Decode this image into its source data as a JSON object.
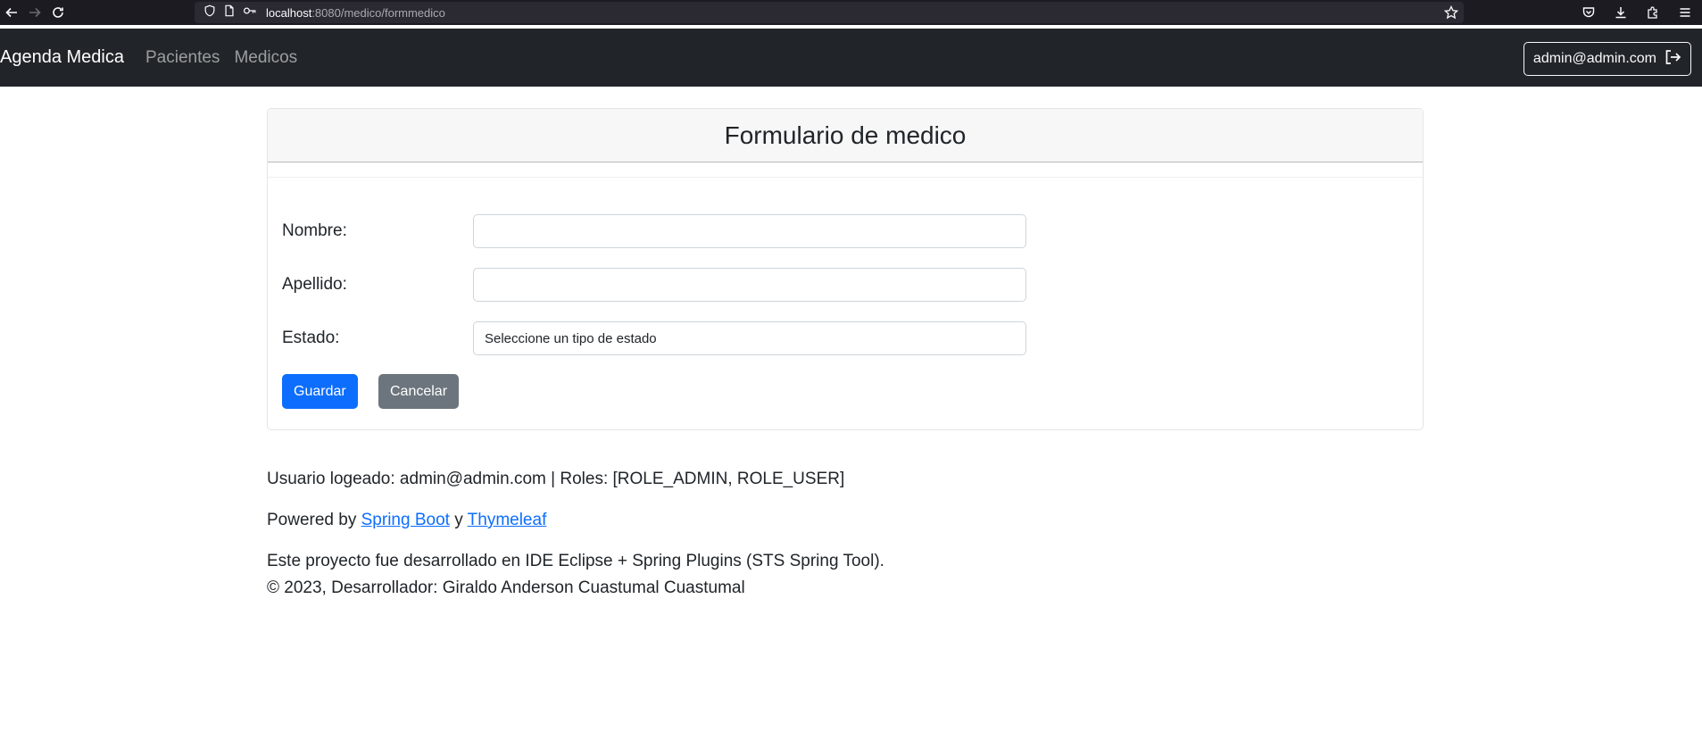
{
  "browser": {
    "url_host": "localhost",
    "url_path": ":8080/medico/formmedico",
    "icons": [
      "back-arrow-icon",
      "forward-arrow-icon",
      "reload-icon",
      "shield-icon",
      "page-icon",
      "key-icon",
      "bookmark-star-icon",
      "pocket-icon",
      "download-icon",
      "extensions-icon",
      "menu-icon"
    ]
  },
  "navbar": {
    "brand": "Agenda Medica",
    "links": [
      {
        "label": "Pacientes"
      },
      {
        "label": "Medicos"
      }
    ],
    "user_label": "admin@admin.com",
    "logout_icon": "logout-icon"
  },
  "form": {
    "title": "Formulario de medico",
    "fields": [
      {
        "label": "Nombre:",
        "value": "",
        "type": "text"
      },
      {
        "label": "Apellido:",
        "value": "",
        "type": "text"
      },
      {
        "label": "Estado:",
        "value": "Seleccione un tipo de estado",
        "type": "select"
      }
    ],
    "save_label": "Guardar",
    "cancel_label": "Cancelar"
  },
  "footer": {
    "user_info": "Usuario logeado: admin@admin.com | Roles: [ROLE_ADMIN, ROLE_USER]",
    "powered_prefix": "Powered by ",
    "spring_boot": "Spring Boot",
    "powered_and": " y ",
    "thymeleaf": "Thymeleaf",
    "project_line": "Este proyecto fue desarrollado en IDE Eclipse + Spring Plugins (STS Spring Tool).",
    "copyright_line": "© 2023, Desarrollador: Giraldo Anderson Cuastumal Cuastumal"
  },
  "colors": {
    "navbar_bg": "#212529",
    "primary": "#0d6efd",
    "secondary": "#6c757d",
    "browser_bg": "#1c1b22"
  }
}
